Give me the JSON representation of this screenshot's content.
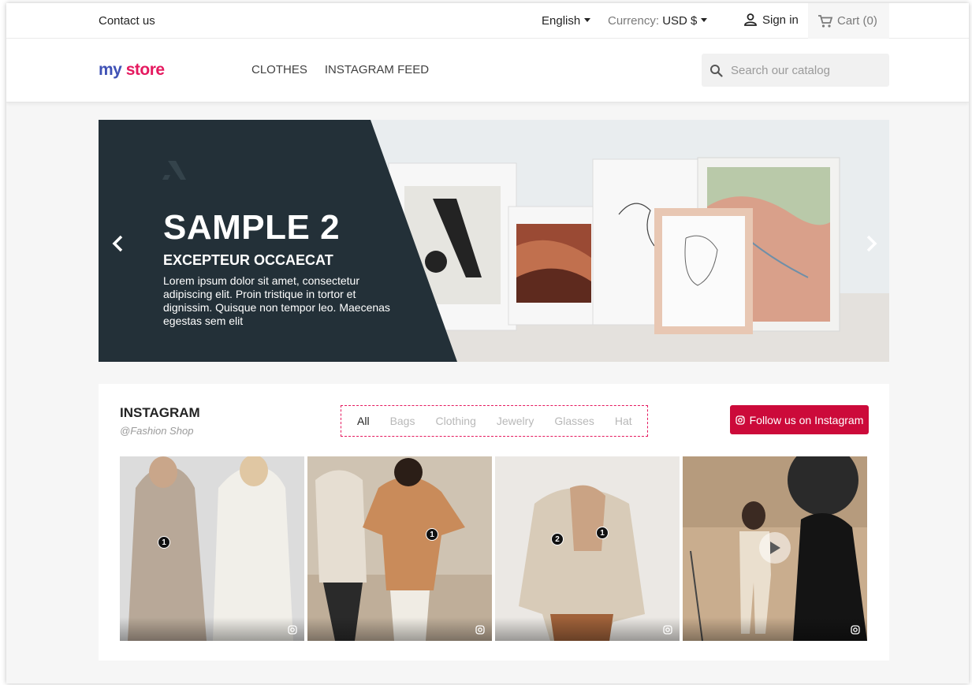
{
  "topbar": {
    "contact": "Contact us",
    "language": "English",
    "currency_label": "Currency:",
    "currency_value": "USD $",
    "signin": "Sign in",
    "cart": "Cart (0)"
  },
  "header": {
    "logo_part1": "my",
    "logo_part2": "store",
    "nav": [
      "CLOTHES",
      "INSTAGRAM FEED"
    ],
    "search_placeholder": "Search our catalog"
  },
  "slider": {
    "title": "SAMPLE 2",
    "subtitle": "EXCEPTEUR OCCAECAT",
    "text": "Lorem ipsum dolor sit amet, consectetur adipiscing elit. Proin tristique in tortor et dignissim. Quisque non tempor leo. Maecenas egestas sem elit"
  },
  "instagram": {
    "title": "INSTAGRAM",
    "handle": "@Fashion Shop",
    "filters": [
      "All",
      "Bags",
      "Clothing",
      "Jewelry",
      "Glasses",
      "Hat"
    ],
    "active_filter": "All",
    "follow_label": "Follow us on Instagram",
    "tiles": [
      {
        "tags": [
          "1"
        ]
      },
      {
        "tags": [
          "1"
        ]
      },
      {
        "tags": [
          "2",
          "1"
        ]
      },
      {
        "video": true
      }
    ]
  },
  "colors": {
    "accent": "#cc0a3a",
    "logo_blue": "#3f51b5",
    "logo_pink": "#e5195f",
    "slide_panel": "#233038"
  }
}
